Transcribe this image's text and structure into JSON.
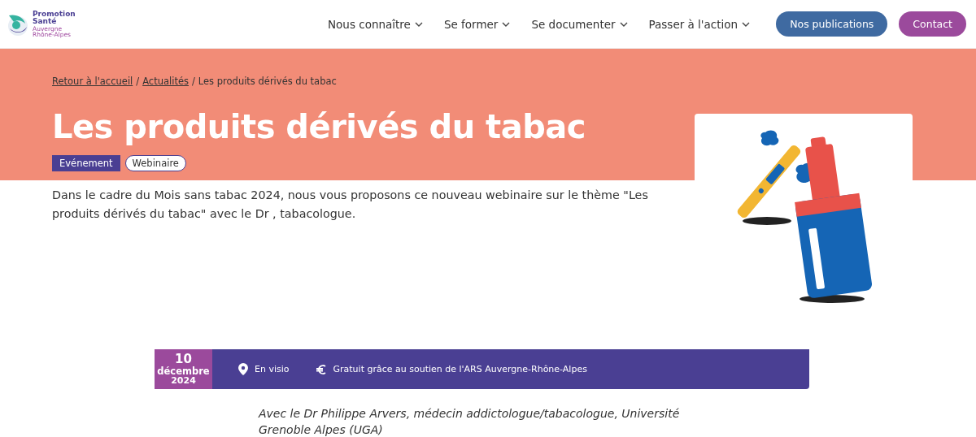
{
  "logo": {
    "name": "Promotion Santé",
    "region": "Auvergne Rhône-Alpes"
  },
  "nav": [
    {
      "label": "Nous connaître"
    },
    {
      "label": "Se former"
    },
    {
      "label": "Se documenter"
    },
    {
      "label": "Passer à l'action"
    }
  ],
  "buttons": [
    {
      "label": "Nos publications",
      "kind": "publications"
    },
    {
      "label": "Contact",
      "kind": "contact"
    }
  ],
  "breadcrumb": [
    {
      "label": "Retour à l'accueil",
      "kind": "link"
    },
    {
      "label": "/",
      "kind": "separator"
    },
    {
      "label": "Actualités",
      "kind": "link"
    },
    {
      "label": "/",
      "kind": "separator"
    },
    {
      "label": "Les produits dérivés du tabac",
      "kind": "current"
    }
  ],
  "title": "Les produits dérivés du tabac",
  "tags": [
    {
      "label": "Evénement",
      "kind": "filled"
    },
    {
      "label": "Webinaire",
      "kind": "outline"
    }
  ],
  "intro": "Dans le cadre du Mois sans tabac 2024, nous vous proposons ce nouveau webinaire sur le thème \"Les produits dérivés du tabac\" avec le Dr , tabacologue.",
  "event": {
    "day": "10",
    "month": "décembre",
    "year": "2024",
    "place": "En visio",
    "price": "Gratuit grâce au soutien de l'ARS Auvergne-Rhône-Alpes"
  },
  "speaker": "Avec le Dr Philippe Arvers, médecin addictologue/tabacologue, Université Grenoble Alpes (UGA)"
}
